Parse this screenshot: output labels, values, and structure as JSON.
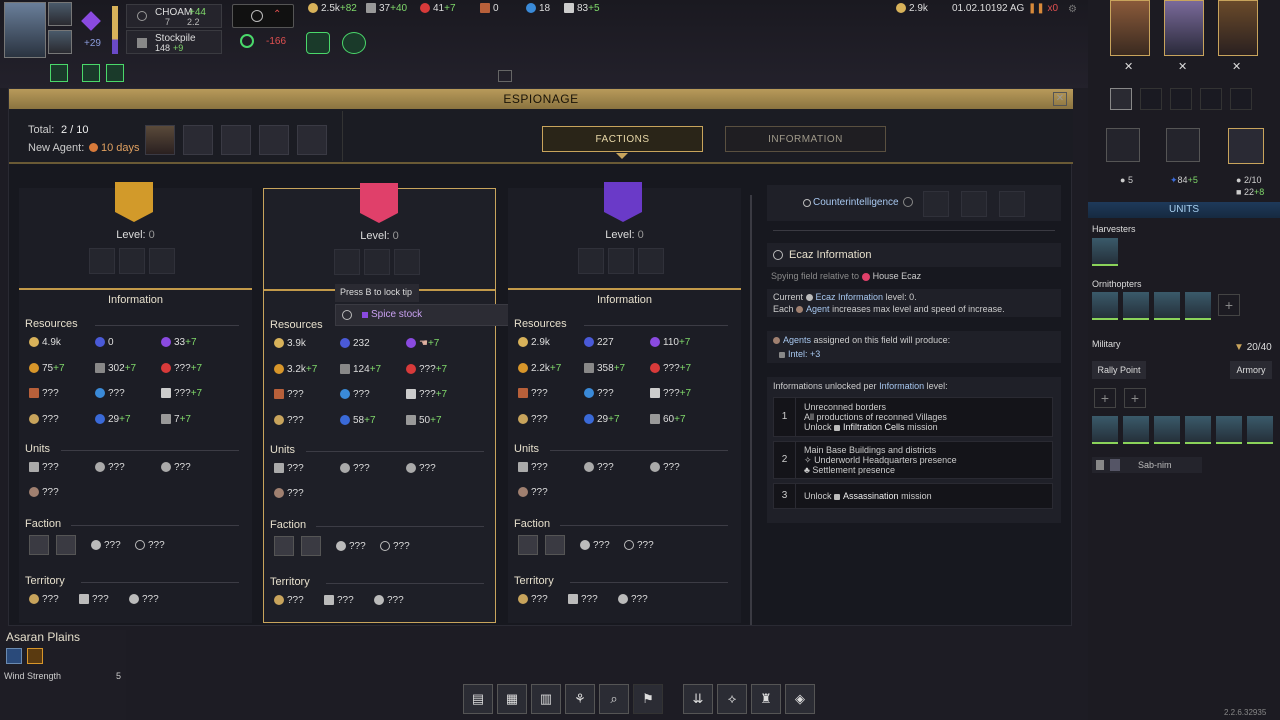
{
  "topbar": {
    "agents_count": "+29",
    "choam": {
      "label": "CHOAM",
      "value1": "+44",
      "sub1": "7",
      "sub2": "2.2"
    },
    "stockpile": {
      "label": "Stockpile",
      "value": "148",
      "delta": "+9"
    },
    "hostility": "-166",
    "resources": [
      {
        "icon": "solari-icon",
        "value": "2.5k",
        "delta": "+82"
      },
      {
        "icon": "plascrete-icon",
        "value": "37",
        "delta": "+40"
      },
      {
        "icon": "authority-icon",
        "value": "41",
        "delta": "+7"
      },
      {
        "icon": "fuel-cell-icon",
        "value": "0",
        "delta": ""
      },
      {
        "icon": "water-icon",
        "value": "18",
        "delta": ""
      },
      {
        "icon": "landsraad-icon",
        "value": "83",
        "delta": "+5"
      }
    ],
    "right": {
      "influence": "2.9k",
      "date": "01.02.10192 AG",
      "pause": "x0"
    }
  },
  "espionage": {
    "title": "ESPIONAGE",
    "total_label": "Total:",
    "total_value": "2 / 10",
    "new_agent_label": "New Agent:",
    "new_agent_value": "10 days",
    "tabs": {
      "factions": "FACTIONS",
      "information": "INFORMATION"
    },
    "tooltip": {
      "hint": "Press B to lock tip",
      "text": "Spice stock"
    },
    "factions": [
      {
        "color": "#d29a2a",
        "level_label": "Level:",
        "level": "0",
        "info_label": "Information",
        "resources_label": "Resources",
        "resources": [
          [
            "4.9k",
            "0",
            "33",
            "+7"
          ],
          [
            "75",
            "+7",
            "302",
            "+7",
            "???",
            "+7"
          ],
          [
            "???",
            "???",
            "???",
            "+7"
          ],
          [
            "???",
            "29",
            "+7",
            "7",
            "+7"
          ]
        ],
        "units_label": "Units",
        "units": [
          "???",
          "???",
          "???",
          "???"
        ],
        "faction_label": "Faction",
        "faction_vals": [
          "???",
          "???"
        ],
        "territory_label": "Territory",
        "territory": [
          "???",
          "???",
          "???"
        ]
      },
      {
        "color": "#e0406a",
        "level_label": "Level:",
        "level": "0",
        "info_label": "Information",
        "resources_label": "Resources",
        "units_label": "Units",
        "units": [
          "???",
          "???",
          "???",
          "???"
        ],
        "faction_label": "Faction",
        "faction_vals": [
          "???",
          "???"
        ],
        "territory_label": "Territory",
        "territory": [
          "???",
          "???",
          "???"
        ]
      },
      {
        "color": "#6a3ac8",
        "level_label": "Level:",
        "level": "0",
        "info_label": "Information",
        "resources_label": "Resources",
        "units_label": "Units",
        "units": [
          "???",
          "???",
          "???",
          "???"
        ],
        "faction_label": "Faction",
        "faction_vals": [
          "???",
          "???"
        ],
        "territory_label": "Territory",
        "territory": [
          "???",
          "???",
          "???"
        ]
      }
    ],
    "res_values": {
      "f1": {
        "solari": "4.9k",
        "plas": "0",
        "spice": "33",
        "spice_d": "+7",
        "food": "75",
        "food_d": "+7",
        "stone": "302",
        "stone_d": "+7",
        "auth": "???",
        "auth_d": "+7",
        "fuel": "???",
        "water": "???",
        "land": "???",
        "land_d": "+7",
        "intel": "???",
        "knw": "29",
        "knw_d": "+7",
        "misc": "7",
        "misc_d": "+7"
      },
      "f2": {
        "solari": "3.9k",
        "plas": "232",
        "spice": "",
        "spice_d": "+7",
        "food": "3.2k",
        "food_d": "+7",
        "stone": "124",
        "stone_d": "+7",
        "auth": "???",
        "auth_d": "+7",
        "fuel": "???",
        "water": "???",
        "land": "???",
        "land_d": "+7",
        "intel": "???",
        "knw": "58",
        "knw_d": "+7",
        "misc": "50",
        "misc_d": "+7"
      },
      "f3": {
        "solari": "2.9k",
        "plas": "227",
        "spice": "110",
        "spice_d": "+7",
        "food": "2.2k",
        "food_d": "+7",
        "stone": "358",
        "stone_d": "+7",
        "auth": "???",
        "auth_d": "+7",
        "fuel": "???",
        "water": "???",
        "land": "???",
        "land_d": "+7",
        "intel": "???",
        "knw": "29",
        "knw_d": "+7",
        "misc": "60",
        "misc_d": "+7"
      }
    },
    "info_panel": {
      "counterintel": "Counterintelligence",
      "field_title": "Ecaz Information",
      "field_sub_prefix": "Spying field relative to",
      "field_sub_house": "House Ecaz",
      "current_prefix": "Current",
      "current_name": "Ecaz Information",
      "current_suffix": "level: 0.",
      "each_line": "Each",
      "each_agent": "Agent",
      "each_rest": "increases max level and speed of increase.",
      "assigned_label": "Agents",
      "assigned_rest": "assigned on this field will produce:",
      "intel_line": "Intel: +3",
      "unlocked_title_a": "Informations unlocked per",
      "unlocked_title_b": "Information",
      "unlocked_title_c": "level:",
      "levels": [
        {
          "num": "1",
          "lines": [
            "Unreconned borders",
            "All productions of reconned Villages"
          ],
          "unlock_prefix": "Unlock",
          "unlock_name": "Infiltration Cells",
          "unlock_suffix": "mission"
        },
        {
          "num": "2",
          "lines": [
            "Main Base Buildings and districts",
            "Underworld Headquarters presence",
            "Settlement presence"
          ],
          "unlock_prefix": "",
          "unlock_name": "",
          "unlock_suffix": ""
        },
        {
          "num": "3",
          "lines": [],
          "unlock_prefix": "Unlock",
          "unlock_name": "Assassination",
          "unlock_suffix": "mission"
        }
      ]
    }
  },
  "sidebar": {
    "stat1": "5",
    "stat2": "84",
    "stat2_d": "+5",
    "stat3": "2/10",
    "stat4": "22",
    "stat4_d": "+8",
    "units_title": "UNITS",
    "harvesters_label": "Harvesters",
    "ornithopters_label": "Ornithopters",
    "military_label": "Military",
    "military_count": "20/40",
    "rally_point": "Rally Point",
    "armory": "Armory",
    "general": "Sab-nim"
  },
  "region": {
    "name": "Asaran Plains",
    "stat_label": "Wind Strength",
    "stat_value": "5"
  },
  "version": "2.2.6.32935",
  "colors": {
    "gold": "#c8a45c",
    "accent_green": "#7fd86a",
    "red": "#e05050"
  }
}
